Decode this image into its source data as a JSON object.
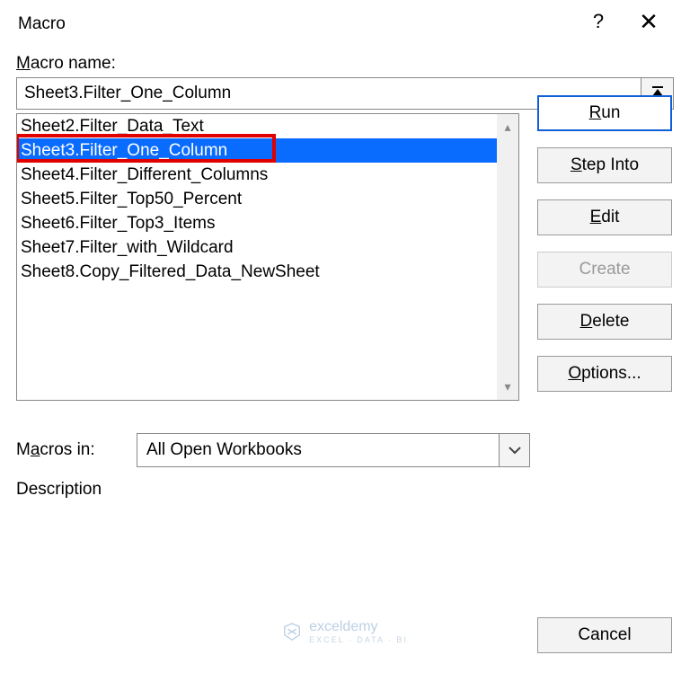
{
  "titlebar": {
    "title": "Macro",
    "help": "?",
    "close": "✕"
  },
  "labels": {
    "macro_name": "Macro name:",
    "macros_in": "Macros in:",
    "description": "Description"
  },
  "input": {
    "macro_name_value": "Sheet3.Filter_One_Column"
  },
  "list": {
    "items": [
      "Sheet2.Filter_Data_Text",
      "Sheet3.Filter_One_Column",
      "Sheet4.Filter_Different_Columns",
      "Sheet5.Filter_Top50_Percent",
      "Sheet6.Filter_Top3_Items",
      "Sheet7.Filter_with_Wildcard",
      "Sheet8.Copy_Filtered_Data_NewSheet"
    ],
    "selected_index": 1
  },
  "combo": {
    "macros_in_value": "All Open Workbooks"
  },
  "buttons": {
    "run": "Run",
    "step_into": "Step Into",
    "edit": "Edit",
    "create": "Create",
    "delete": "Delete",
    "options": "Options...",
    "cancel": "Cancel"
  },
  "watermark": {
    "brand": "exceldemy",
    "tag": "EXCEL · DATA · BI"
  }
}
